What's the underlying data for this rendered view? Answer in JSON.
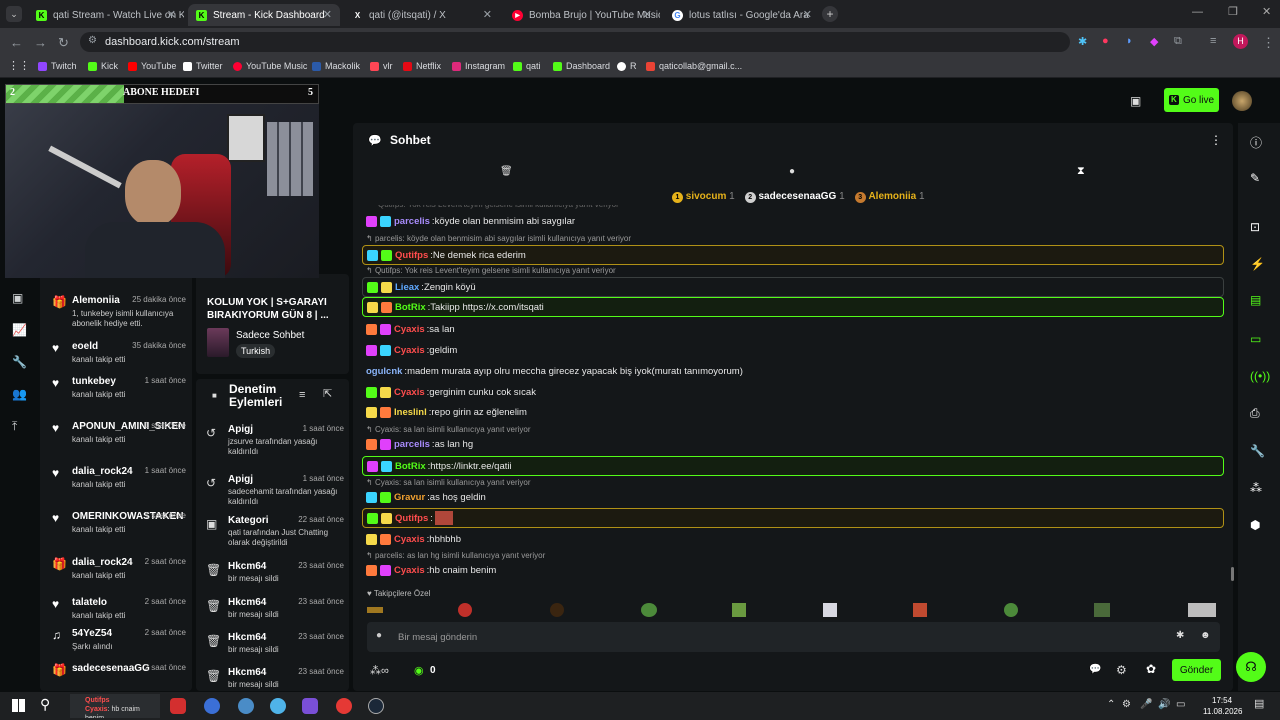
{
  "browser": {
    "tabs": [
      {
        "title": "qati Stream - Watch Live on Kick",
        "color": "#53fc18",
        "glyph": "K"
      },
      {
        "title": "Stream - Kick Dashboard",
        "color": "#53fc18",
        "glyph": "K"
      },
      {
        "title": "qati (@itsqati) / X",
        "color": "#ffffff",
        "glyph": "X"
      },
      {
        "title": "Bomba Brujo | YouTube Music",
        "color": "#ff0033",
        "glyph": "▶"
      },
      {
        "title": "lotus tatlısı - Google'da Ara",
        "color": "#ffffff",
        "glyph": "G"
      }
    ],
    "url": "dashboard.kick.com/stream",
    "bookmarks": [
      {
        "label": "Twitch",
        "color": "#9146ff"
      },
      {
        "label": "Kick",
        "color": "#53fc18"
      },
      {
        "label": "YouTube",
        "color": "#ff0000"
      },
      {
        "label": "Twitter",
        "color": "#ffffff"
      },
      {
        "label": "YouTube Music",
        "color": "#ff0033"
      },
      {
        "label": "Mackolik",
        "color": "#2b5aa8"
      },
      {
        "label": "vlr",
        "color": "#ff4655"
      },
      {
        "label": "Netflix",
        "color": "#e50914"
      },
      {
        "label": "Instagram",
        "color": "#dd2a7b"
      },
      {
        "label": "qati",
        "color": "#53fc18"
      },
      {
        "label": "Dashboard",
        "color": "#53fc18"
      },
      {
        "label": "R",
        "color": "#ffffff"
      },
      {
        "label": "qaticollab@gmail.c...",
        "color": "#ea4335"
      }
    ],
    "profile_initial": "H"
  },
  "header": {
    "go_live": "Go live"
  },
  "overlay": {
    "goal_title": "ABONE HEDEFI",
    "goal_current": "2",
    "goal_target": "5"
  },
  "stream_info": {
    "title": "KOLUM YOK | S+GARAYI BIRAKIYORUM GÜN 8 | ...",
    "category": "Sadece Sohbet",
    "tag": "Turkish"
  },
  "activity": [
    {
      "name": "Alemoniia",
      "time": "25 dakika önce",
      "desc": "1, tunkebey isimli kullanıcıya abonelik hediye etti.",
      "icon": "gift"
    },
    {
      "name": "eoeld",
      "time": "35 dakika önce",
      "desc": "kanalı takip etti",
      "icon": "heart"
    },
    {
      "name": "tunkebey",
      "time": "1 saat önce",
      "desc": "kanalı takip etti",
      "icon": "heart"
    },
    {
      "name": "APONUN_AMINI_SIKEN",
      "time": "1 saat önce",
      "desc": "kanalı takip etti",
      "icon": "heart"
    },
    {
      "name": "dalia_rock24",
      "time": "1 saat önce",
      "desc": "kanalı takip etti",
      "icon": "heart"
    },
    {
      "name": "OMERINKOWASTAKEN",
      "time": "1 saat önce",
      "desc": "kanalı takip etti",
      "icon": "heart"
    },
    {
      "name": "dalia_rock24",
      "time": "2 saat önce",
      "desc": "kanalı takip etti",
      "icon": "gift"
    },
    {
      "name": "talatelo",
      "time": "2 saat önce",
      "desc": "kanalı takip etti",
      "icon": "heart"
    },
    {
      "name": "54YeZ54",
      "time": "2 saat önce",
      "desc": "Şarkı alındı",
      "icon": "music"
    },
    {
      "name": "sadecesenaaGG",
      "time": "2 saat önce",
      "desc": "",
      "icon": "gift"
    }
  ],
  "moderation": {
    "title": "Denetim Eylemleri",
    "items": [
      {
        "name": "Apigj",
        "time": "1 saat önce",
        "desc": "jzsurve tarafından yasağı kaldırıldı",
        "icon": "undo"
      },
      {
        "name": "Apigj",
        "time": "1 saat önce",
        "desc": "sadecehamit tarafından yasağı kaldırıldı",
        "icon": "undo"
      },
      {
        "name": "Kategori",
        "time": "22 saat önce",
        "desc": "qati tarafından Just Chatting olarak değiştirildi",
        "icon": "category"
      },
      {
        "name": "Hkcm64",
        "time": "23 saat önce",
        "desc": "bir mesajı sildi",
        "icon": "trash"
      },
      {
        "name": "Hkcm64",
        "time": "23 saat önce",
        "desc": "bir mesajı sildi",
        "icon": "trash"
      },
      {
        "name": "Hkcm64",
        "time": "23 saat önce",
        "desc": "bir mesajı sildi",
        "icon": "trash"
      },
      {
        "name": "Hkcm64",
        "time": "23 saat önce",
        "desc": "bir mesajı sildi",
        "icon": "trash"
      }
    ]
  },
  "chat": {
    "title": "Sohbet",
    "leaderboard": [
      {
        "rank": "1",
        "name": "sivocum",
        "count": "1"
      },
      {
        "rank": "2",
        "name": "sadecesenaaGG",
        "count": "1"
      },
      {
        "rank": "3",
        "name": "Alemoniia",
        "count": "1"
      }
    ],
    "top_cut": "Qutifps: Yok reis Levent'teyim gelsene isimli kullanıcıya yanıt veriyor",
    "messages": [
      {
        "reply": "",
        "user": "parcelis",
        "text": "köyde olan benmisim abi saygılar",
        "color": "#a78bfa",
        "style": ""
      },
      {
        "reply": "parcelis: köyde olan benmisim abi saygılar isimli kullanıcıya yanıt veriyor",
        "user": "Qutifps",
        "text": "Ne demek rica ederim",
        "color": "#ff4d4d",
        "style": "hl"
      },
      {
        "reply": "Qutifps: Yok reis Levent'teyim gelsene isimli kullanıcıya yanıt veriyor",
        "user": "Lieax",
        "text": "Zengin köyü",
        "color": "#5fa8ff",
        "style": "hlr"
      },
      {
        "reply": "",
        "user": "BotRix",
        "text": "Takiipp https://x.com/itsqati",
        "color": "#53fc18",
        "style": "hlg"
      },
      {
        "reply": "",
        "user": "Cyaxis",
        "text": "sa lan",
        "color": "#ff4d4d",
        "style": ""
      },
      {
        "reply": "",
        "user": "Cyaxis",
        "text": "geldim",
        "color": "#ff4d4d",
        "style": ""
      },
      {
        "reply": "",
        "user": "ogulcnk",
        "text": "madem murata ayıp olru meccha girecez yapacak biş iyok(muratı tanımoyorum)",
        "color": "#8ab4f8",
        "style": ""
      },
      {
        "reply": "",
        "user": "Cyaxis",
        "text": "gerginim cunku cok sıcak",
        "color": "#ff4d4d",
        "style": ""
      },
      {
        "reply": "",
        "user": "Ineslinl",
        "text": "repo girin az eğlenelim",
        "color": "#f5d94a",
        "style": ""
      },
      {
        "reply": "Cyaxis: sa lan isimli kullanıcıya yanıt veriyor",
        "user": "parcelis",
        "text": "as lan hg",
        "color": "#a78bfa",
        "style": ""
      },
      {
        "reply": "",
        "user": "BotRix",
        "text": "https://linktr.ee/qatii",
        "color": "#53fc18",
        "style": "hlg"
      },
      {
        "reply": "Cyaxis: sa lan isimli kullanıcıya yanıt veriyor",
        "user": "Gravur",
        "text": "as hoş geldin",
        "color": "#f0a030",
        "style": ""
      },
      {
        "reply": "",
        "user": "Qutifps",
        "text": "",
        "color": "#ff4d4d",
        "style": "hl"
      },
      {
        "reply": "",
        "user": "Cyaxis",
        "text": "hbhbhb",
        "color": "#ff4d4d",
        "style": ""
      },
      {
        "reply": "parcelis: as lan hg isimli kullanıcıya yanıt veriyor",
        "user": "Cyaxis",
        "text": "hb cnaim benim",
        "color": "#ff4d4d",
        "style": ""
      }
    ],
    "followers_only_label": "Takipçilere Özel",
    "input_placeholder": "Bir mesaj gönderin",
    "points": "0",
    "send": "Gönder"
  },
  "taskbar": {
    "time": "17:54",
    "date": "11.08.2026"
  },
  "colors": {
    "kick_green": "#53fc18",
    "panel": "#141719",
    "background": "#0b0e0f"
  }
}
